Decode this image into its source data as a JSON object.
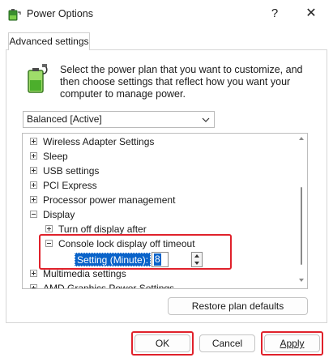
{
  "window": {
    "title": "Power Options",
    "help_glyph": "?",
    "close_glyph": "✕"
  },
  "tabs": [
    {
      "label": "Advanced settings"
    }
  ],
  "description": "Select the power plan that you want to customize, and then choose settings that reflect how you want your computer to manage power.",
  "plan_dropdown": {
    "selected": "Balanced [Active]"
  },
  "tree": {
    "items": [
      {
        "label": "Wireless Adapter Settings",
        "state": "collapsed"
      },
      {
        "label": "Sleep",
        "state": "collapsed"
      },
      {
        "label": "USB settings",
        "state": "collapsed"
      },
      {
        "label": "PCI Express",
        "state": "collapsed"
      },
      {
        "label": "Processor power management",
        "state": "collapsed"
      },
      {
        "label": "Display",
        "state": "expanded"
      },
      {
        "label": "Turn off display after",
        "state": "collapsed"
      },
      {
        "label": "Console lock display off timeout",
        "state": "expanded"
      },
      {
        "label": "Multimedia settings",
        "state": "collapsed"
      },
      {
        "label": "AMD Graphics Power Settings",
        "state": "collapsed"
      }
    ],
    "setting": {
      "label": "Setting (Minute):",
      "value": "8"
    }
  },
  "buttons": {
    "restore": "Restore plan defaults",
    "ok": "OK",
    "cancel": "Cancel",
    "apply": "Apply"
  },
  "colors": {
    "highlight_box": "#e0212b",
    "selection": "#0a63c9"
  },
  "icons": {
    "app": "power-options-icon",
    "battery": "battery-plug-icon"
  }
}
